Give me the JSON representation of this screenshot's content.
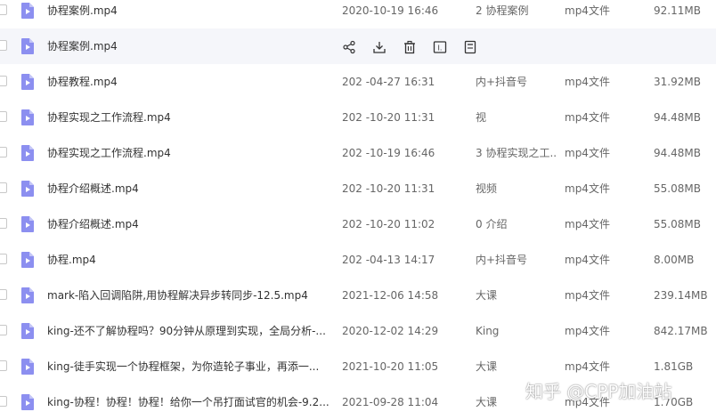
{
  "colors": {
    "accent": "#7b7de8",
    "hover_row": "#f5f6fa",
    "text": "#333333",
    "muted": "#666666"
  },
  "rows": [
    {
      "name": "协程案例.mp4",
      "time": "2020-10-19 16:46",
      "dir": "2 协程案例",
      "type": "mp4文件",
      "size": "92.11MB"
    },
    {
      "name": "协程案例.mp4",
      "hover": true
    },
    {
      "name": "协程教程.mp4",
      "time": "202   -04-27 16:31",
      "dir": "内+抖音号",
      "type": "mp4文件",
      "size": "31.92MB"
    },
    {
      "name": "协程实现之工作流程.mp4",
      "time": "202   -10-20 11:31",
      "dir": "视",
      "type": "mp4文件",
      "size": "94.48MB"
    },
    {
      "name": "协程实现之工作流程.mp4",
      "time": "202   -10-19 16:46",
      "dir": "3 协程实现之工...",
      "type": "mp4文件",
      "size": "94.48MB"
    },
    {
      "name": "协程介绍概述.mp4",
      "time": "202   -10-20 11:31",
      "dir": "视频",
      "type": "mp4文件",
      "size": "55.08MB"
    },
    {
      "name": "协程介绍概述.mp4",
      "time": "202   -10-20 11:02",
      "dir": "0 介绍",
      "type": "mp4文件",
      "size": "55.08MB"
    },
    {
      "name": "协程.mp4",
      "time": "202   -04-13 14:17",
      "dir": "内+抖音号",
      "type": "mp4文件",
      "size": "8.00MB"
    },
    {
      "name": "mark-陷入回调陷阱,用协程解决异步转同步-12.5.mp4",
      "time": "2021-12-06 14:58",
      "dir": "大课",
      "type": "mp4文件",
      "size": "239.14MB"
    },
    {
      "name": "king-还不了解协程吗？90分钟从原理到实现，全局分析-...",
      "time": "2020-12-02 14:29",
      "dir": "King",
      "type": "mp4文件",
      "size": "842.17MB"
    },
    {
      "name": "king-徒手实现一个协程框架，为你造轮子事业，再添一...",
      "time": "2021-10-20 11:05",
      "dir": "大课",
      "type": "mp4文件",
      "size": "1.81GB"
    },
    {
      "name": "king-协程！协程！协程！给你一个吊打面试官的机会-9.2...",
      "time": "2021-09-28 11:04",
      "dir": "大课",
      "type": "mp4文件",
      "size": "1.70GB"
    }
  ],
  "row_actions": [
    "share-icon",
    "download-icon",
    "delete-icon",
    "rename-icon",
    "more-icon"
  ],
  "watermark": "知乎 @CPP加油站"
}
